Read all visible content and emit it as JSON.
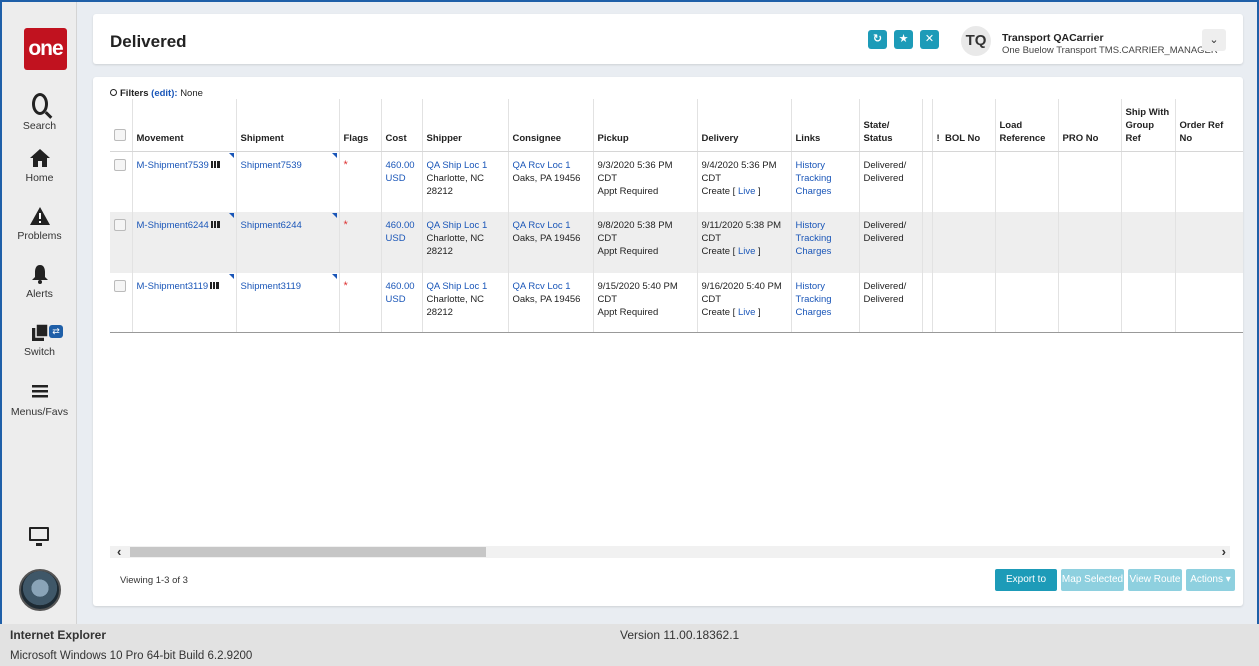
{
  "nav": {
    "logo": "one",
    "items": [
      {
        "label": "Search",
        "icon": "search-icon"
      },
      {
        "label": "Home",
        "icon": "home-icon"
      },
      {
        "label": "Problems",
        "icon": "warning-icon"
      },
      {
        "label": "Alerts",
        "icon": "bell-icon"
      },
      {
        "label": "Switch",
        "icon": "switch-icon"
      },
      {
        "label": "Menus/Favs",
        "icon": "menu-icon"
      }
    ]
  },
  "header": {
    "title": "Delivered",
    "user_initials": "TQ",
    "user_name": "Transport QACarrier",
    "user_role": "One Buelow Transport TMS.CARRIER_MANAGER",
    "accent": "#1d9bb8"
  },
  "filters": {
    "label": "Filters",
    "edit": "(edit):",
    "value": "None"
  },
  "table": {
    "columns": [
      "Movement",
      "Shipment",
      "Flags",
      "Cost",
      "Shipper",
      "Consignee",
      "Pickup",
      "Delivery",
      "Links",
      "State/ Status",
      "!",
      "BOL No",
      "Load Reference",
      "PRO No",
      "Ship With Group Ref",
      "Order Ref No"
    ],
    "rows": [
      {
        "movement": "M-Shipment7539",
        "shipment": "Shipment7539",
        "flag": "*",
        "cost_amount": "460.00",
        "cost_currency": "USD",
        "shipper_name": "QA Ship Loc 1",
        "shipper_city": "Charlotte, NC 28212",
        "consignee_name": "QA Rcv Loc 1",
        "consignee_city": "Oaks, PA 19456",
        "pickup_time": "9/3/2020 5:36 PM CDT",
        "pickup_note": "Appt Required",
        "delivery_time": "9/4/2020 5:36 PM CDT",
        "delivery_create": "Create [",
        "delivery_live": "Live",
        "delivery_close": "]",
        "link_history": "History",
        "link_tracking": "Tracking",
        "link_charges": "Charges",
        "state": "Delivered/",
        "status": "Delivered"
      },
      {
        "movement": "M-Shipment6244",
        "shipment": "Shipment6244",
        "flag": "*",
        "cost_amount": "460.00",
        "cost_currency": "USD",
        "shipper_name": "QA Ship Loc 1",
        "shipper_city": "Charlotte, NC 28212",
        "consignee_name": "QA Rcv Loc 1",
        "consignee_city": "Oaks, PA 19456",
        "pickup_time": "9/8/2020 5:38 PM CDT",
        "pickup_note": "Appt Required",
        "delivery_time": "9/11/2020 5:38 PM CDT",
        "delivery_create": "Create [",
        "delivery_live": "Live",
        "delivery_close": "]",
        "link_history": "History",
        "link_tracking": "Tracking",
        "link_charges": "Charges",
        "state": "Delivered/",
        "status": "Delivered"
      },
      {
        "movement": "M-Shipment3119",
        "shipment": "Shipment3119",
        "flag": "*",
        "cost_amount": "460.00",
        "cost_currency": "USD",
        "shipper_name": "QA Ship Loc 1",
        "shipper_city": "Charlotte, NC 28212",
        "consignee_name": "QA Rcv Loc 1",
        "consignee_city": "Oaks, PA 19456",
        "pickup_time": "9/15/2020 5:40 PM CDT",
        "pickup_note": "Appt Required",
        "delivery_time": "9/16/2020 5:40 PM CDT",
        "delivery_create": "Create [",
        "delivery_live": "Live",
        "delivery_close": "]",
        "link_history": "History",
        "link_tracking": "Tracking",
        "link_charges": "Charges",
        "state": "Delivered/",
        "status": "Delivered"
      }
    ]
  },
  "footer": {
    "viewing": "Viewing 1-3 of 3",
    "export_csv": "Export to CSV",
    "map_selected": "Map Selected",
    "view_route": "View Route",
    "actions": "Actions ▾"
  },
  "browser": {
    "name": "Internet Explorer",
    "version": "Version 11.00.18362.1",
    "os": "Microsoft Windows 10 Pro 64-bit Build 6.2.9200"
  }
}
